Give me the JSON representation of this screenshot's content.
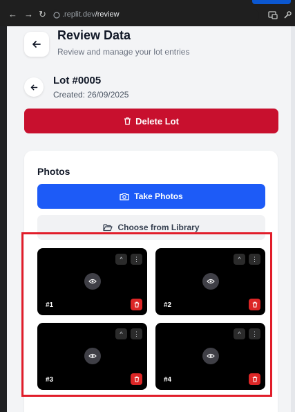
{
  "browser": {
    "url_host": ".replit.dev",
    "url_path": "/review",
    "back_icon": "arrow-left-icon",
    "forward_icon": "arrow-right-icon",
    "reload_icon": "reload-icon"
  },
  "header": {
    "title": "Review Data",
    "subtitle": "Review and manage your lot entries"
  },
  "lot": {
    "title": "Lot #0005",
    "created": "Created: 26/09/2025",
    "delete_label": "Delete Lot"
  },
  "photos": {
    "title": "Photos",
    "take_label": "Take Photos",
    "choose_label": "Choose from Library",
    "items": [
      {
        "label": "#1"
      },
      {
        "label": "#2"
      },
      {
        "label": "#3"
      },
      {
        "label": "#4"
      }
    ]
  },
  "colors": {
    "delete": "#c8102e",
    "primary": "#1d5bf7",
    "highlight": "#e11d2a"
  }
}
